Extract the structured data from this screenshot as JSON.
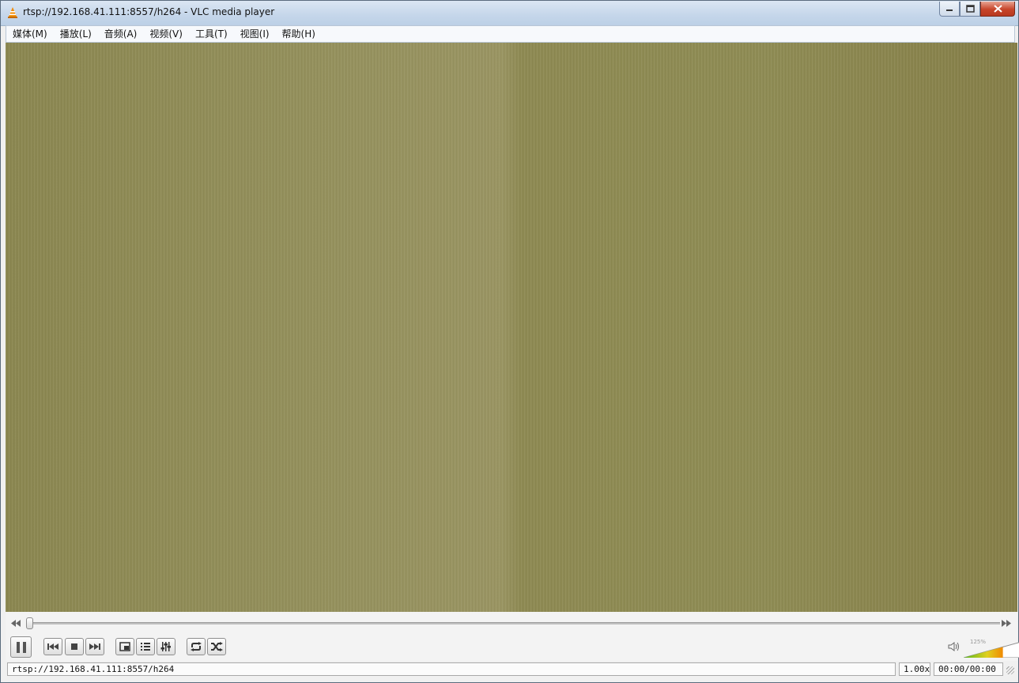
{
  "window": {
    "title": "rtsp://192.168.41.111:8557/h264 - VLC media player"
  },
  "menu": [
    "媒体(M)",
    "播放(L)",
    "音频(A)",
    "视频(V)",
    "工具(T)",
    "视图(I)",
    "帮助(H)"
  ],
  "icons": {
    "app": "vlc-cone-icon",
    "minimize": "minimize-icon",
    "maximize": "restore-icon",
    "close": "close-icon",
    "seek_back": "seek-backward-icon",
    "seek_forward": "seek-forward-icon",
    "pause": "pause-icon",
    "previous": "previous-icon",
    "stop": "stop-icon",
    "next": "next-icon",
    "fullscreen": "fullscreen-icon",
    "playlist": "playlist-icon",
    "effects": "equalizer-icon",
    "loop": "loop-icon",
    "shuffle": "shuffle-icon",
    "volume": "speaker-icon"
  },
  "playback": {
    "position_fraction": 0.0
  },
  "volume": {
    "label": "125%",
    "level_fraction": 0.62
  },
  "status": {
    "media": "rtsp://192.168.41.111:8557/h264",
    "speed": "1.00x",
    "time": "00:00/00:00"
  },
  "colors": {
    "accent": "#f08a00",
    "volume_green": "#58b81e",
    "close_red": "#c7452a"
  }
}
